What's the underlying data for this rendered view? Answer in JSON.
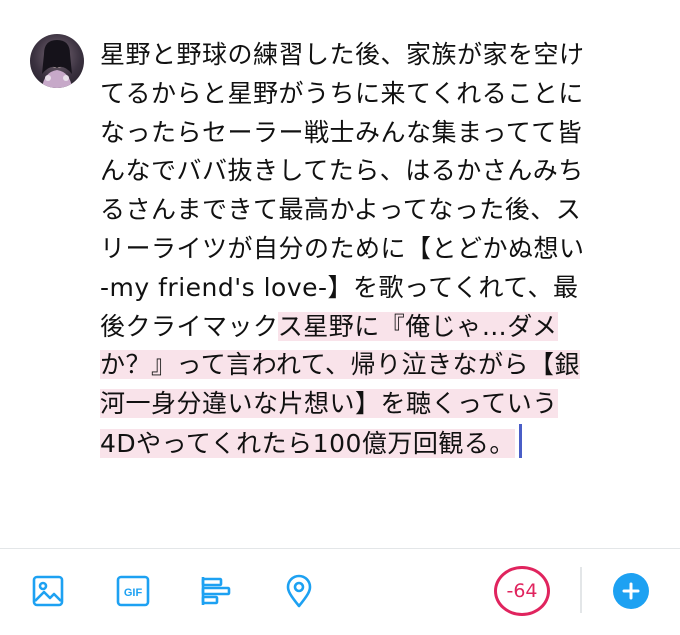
{
  "compose": {
    "lines": [
      {
        "normal": "星野と野球の練習した後、家族が家を空け",
        "over": ""
      },
      {
        "normal": "てるからと星野がうちに来てくれることに",
        "over": ""
      },
      {
        "normal": "なったらセーラー戦士みんな集まってて皆",
        "over": ""
      },
      {
        "normal": "んなでババ抜きしてたら、はるかさんみち",
        "over": ""
      },
      {
        "normal": "るさんまできて最高かよってなった後、ス",
        "over": ""
      },
      {
        "normal": "リーライツが自分のために【とどかぬ想い",
        "over": ""
      },
      {
        "normal": "-my friend's love-】を歌ってくれて、最",
        "over": ""
      },
      {
        "normal": "後クライマック",
        "over": "ス星野に『俺じゃ…ダメ"
      },
      {
        "normal": "",
        "over": "か？』って言われて、帰り泣きながら【銀"
      },
      {
        "normal": "",
        "over": "河一身分違いな片想い】を聴くっていう"
      },
      {
        "normal": "",
        "over": "4Dやってくれたら100億万回観る。"
      }
    ]
  },
  "toolbar": {
    "gif_label": "GIF",
    "char_counter": "-64"
  },
  "colors": {
    "accent": "#1da1f2",
    "over_limit_text": "#e0245e",
    "over_limit_highlight": "#f9e3ea",
    "caret": "#4a5ec7"
  },
  "icons": [
    "avatar",
    "image-icon",
    "gif-icon",
    "poll-icon",
    "location-icon",
    "add-icon"
  ]
}
